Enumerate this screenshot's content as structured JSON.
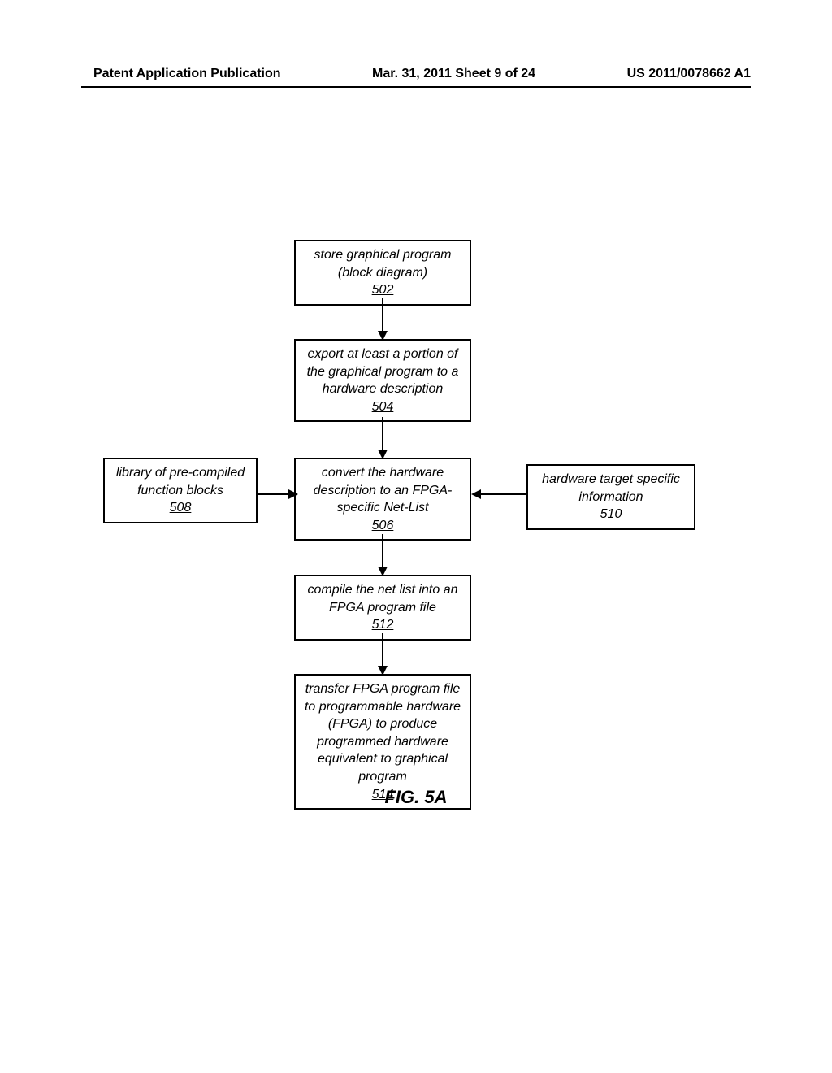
{
  "header": {
    "left": "Patent Application Publication",
    "center": "Mar. 31, 2011  Sheet 9 of 24",
    "right": "US 2011/0078662 A1"
  },
  "boxes": {
    "b502": {
      "text": "store graphical program (block diagram)",
      "ref": "502"
    },
    "b504": {
      "text": "export at least a portion of the graphical program to a hardware description",
      "ref": "504"
    },
    "b506": {
      "text": "convert the hardware description to an FPGA-specific Net-List",
      "ref": "506"
    },
    "b508": {
      "text": "library of pre-compiled function blocks",
      "ref": "508"
    },
    "b510": {
      "text": "hardware target specific information",
      "ref": "510"
    },
    "b512": {
      "text": "compile the net list into an FPGA program file",
      "ref": "512"
    },
    "b514": {
      "text": "transfer FPGA program file to programmable hardware (FPGA) to produce programmed hardware equivalent to graphical program",
      "ref": "514"
    }
  },
  "figure_label": "FIG. 5A"
}
